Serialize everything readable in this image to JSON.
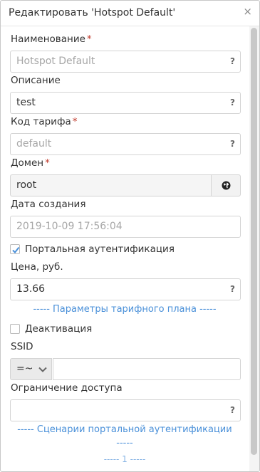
{
  "dialog": {
    "title": "Редактировать 'Hotspot Default'",
    "close_glyph": "×"
  },
  "form": {
    "name": {
      "label": "Наименование",
      "required": "*",
      "value": "Hotspot Default",
      "help": "?"
    },
    "description": {
      "label": "Описание",
      "value": "test",
      "help": "?"
    },
    "tariff_code": {
      "label": "Код тарифа",
      "required": "*",
      "value": "default",
      "help": "?"
    },
    "domain": {
      "label": "Домен",
      "required": "*",
      "value": "root",
      "button_icon": "globe-icon"
    },
    "created": {
      "label": "Дата создания",
      "value": "2019-10-09 17:56:04"
    },
    "portal_auth": {
      "label": "Портальная аутентификация",
      "checked": true
    },
    "price": {
      "label": "Цена, руб.",
      "value": "13.66",
      "help": "?"
    },
    "tariff_params_link": "----- Параметры тарифного плана -----",
    "deactivation": {
      "label": "Деактивация",
      "checked": false
    },
    "ssid": {
      "label": "SSID",
      "operator": "=~",
      "value": ""
    },
    "access_limit": {
      "label": "Ограничение доступа",
      "value": "",
      "help": "?"
    },
    "portal_scenarios_link": "----- Сценарии портальной аутентификации",
    "portal_scenarios_link_tail": "-----",
    "pager": "----- 1 -----"
  },
  "colors": {
    "accent_link": "#4a90d9",
    "required": "#c0392b",
    "checkbox_check": "#4a90d9"
  }
}
